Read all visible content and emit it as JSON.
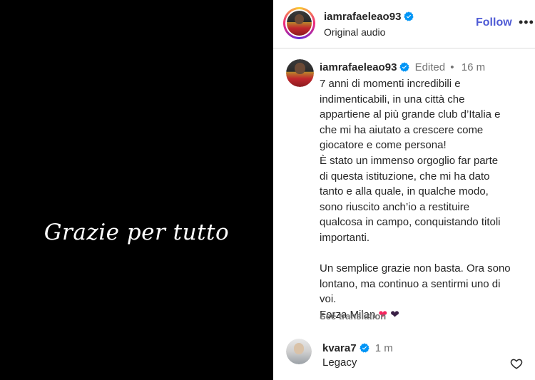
{
  "media": {
    "caption_text": "Grazie per tutto"
  },
  "header": {
    "username": "iamrafaeleao93",
    "audio": "Original audio",
    "follow_label": "Follow",
    "more_label": "•••"
  },
  "post": {
    "username": "iamrafaeleao93",
    "edited": "Edited",
    "separator": "•",
    "time": "16 m",
    "caption_lines": [
      "7 anni di momenti incredibili e",
      "indimenticabili, in una città che",
      "appartiene al più grande club d’Italia e",
      "che mi ha aiutato a crescere come",
      "giocatore e come persona!",
      "È stato un immenso orgoglio far parte",
      "di questa istituzione, che mi ha dato",
      "tanto e alla quale, in qualche modo,",
      "sono riuscito anch’io a restituire",
      "qualcosa in campo, conquistando titoli",
      "importanti."
    ],
    "caption_lines_2": [
      "Un semplice grazie non basta. Ora sono",
      "lontano, ma continuo a sentirmi uno di",
      "voi."
    ],
    "closing": "Forza Milan",
    "see_translation": "See translation"
  },
  "comment": {
    "username": "kvara7",
    "time": "1 m",
    "text": "Legacy"
  },
  "colors": {
    "accent": "#4f5bd5",
    "verified": "#0095f6",
    "muted": "#737373"
  }
}
